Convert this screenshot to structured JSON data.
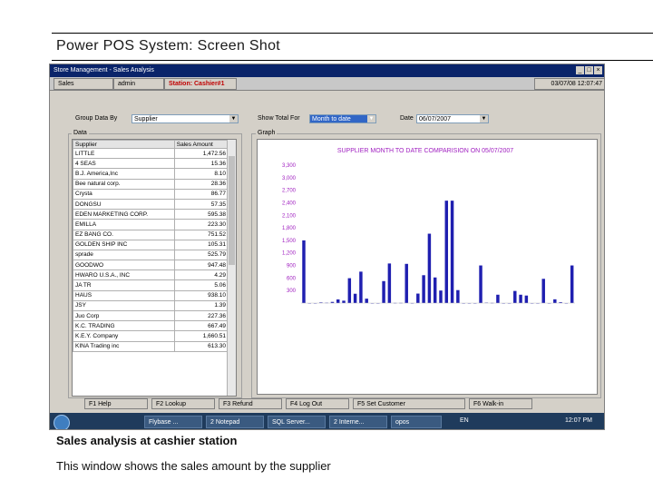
{
  "slide": {
    "title": "Power POS System: Screen Shot",
    "caption_heading": "Sales analysis at cashier station",
    "caption_text": "This window shows the sales amount by the supplier"
  },
  "window": {
    "title": "Store Management - Sales Analysis",
    "status": {
      "module": "Sales",
      "user": "admin",
      "station": "Station: Cashier#1",
      "datetime": "03/07/08 12:07:47"
    },
    "group_by_label": "Group Data By",
    "group_by_value": "Supplier",
    "show_total_label": "Show Total For",
    "show_total_value": "Month to date",
    "date_label": "Date",
    "date_value": "06/07/2007",
    "data_frame_label": "Data",
    "graph_frame_label": "Graph",
    "grid_headers": [
      "Supplier",
      "Sales Amount"
    ],
    "grid_rows": [
      [
        "LITTLE",
        "1,472.56"
      ],
      [
        "4 SEAS",
        "15.36"
      ],
      [
        "B.J. America,Inc",
        "8.10"
      ],
      [
        "Bee natural corp.",
        "28.36"
      ],
      [
        "Crysta",
        "86.77"
      ],
      [
        "DONGSU",
        "57.35"
      ],
      [
        "EDEN MARKETING CORP.",
        "595.38"
      ],
      [
        "EMILLA",
        "223.30"
      ],
      [
        "EZ BANG CO.",
        "751.52"
      ],
      [
        "GOLDEN SHIP INC",
        "105.31"
      ],
      [
        "sprade",
        "525.79"
      ],
      [
        "GOODWO",
        "947.48"
      ],
      [
        "HWARO U.S.A., INC",
        "4.29"
      ],
      [
        "JA TR",
        "5.06"
      ],
      [
        "HAUS",
        "938.10"
      ],
      [
        "JSY",
        "1.39"
      ],
      [
        "Juo Corp",
        "227.36"
      ],
      [
        "K.C. TRADING",
        "667.49"
      ],
      [
        "K.E.Y. Company",
        "1,660.51"
      ],
      [
        "KINA Trading inc",
        "613.30"
      ]
    ],
    "fkeys": [
      "F1 Help",
      "F2 Lookup",
      "F3 Refund",
      "F4 Log Out",
      "F5 Set Customer",
      "F6 Walk-in"
    ],
    "taskbar": {
      "items": [
        "Flybase ...",
        "2 Notepad",
        "SQL Server...",
        "2 Interne...",
        "opos"
      ],
      "lang": "EN",
      "clock": "12:07 PM"
    }
  },
  "chart_data": {
    "type": "bar",
    "title": "SUPPLIER MONTH TO DATE COMPARISION ON 05/07/2007",
    "ylim": [
      0,
      3300
    ],
    "yticks": [
      "3,300",
      "3,000",
      "2,700",
      "2,400",
      "2,100",
      "1,800",
      "1,500",
      "1,200",
      "900",
      "600",
      "300"
    ],
    "values": [
      1500,
      0,
      0,
      15,
      8,
      28,
      87,
      57,
      595,
      223,
      752,
      105,
      0,
      0,
      526,
      947,
      4,
      5,
      938,
      1,
      227,
      667,
      1660,
      613,
      300,
      2450,
      2450,
      310,
      0,
      0,
      0,
      900,
      10,
      5,
      200,
      0,
      0,
      290,
      200,
      180,
      0,
      0,
      580,
      0,
      90,
      20,
      0,
      900
    ],
    "bar_color": "#1f1fb0",
    "ytick_color": "#a020c0",
    "grid": false
  }
}
